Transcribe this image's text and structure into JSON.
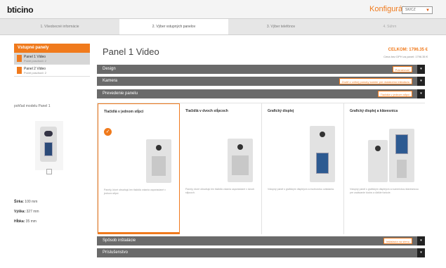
{
  "header": {
    "logo": "bticino",
    "app_title": "Konfigurátor",
    "language": "SK/CZ"
  },
  "wizard": {
    "steps": [
      {
        "label": "1. Všeobecné informácie"
      },
      {
        "label": "2. Výber vstupných panelov"
      },
      {
        "label": "3. Výber telefónov"
      },
      {
        "label": "4. Súhrn"
      }
    ],
    "active_index": 1
  },
  "sidebar": {
    "title": "Vstupné panely",
    "items": [
      {
        "name": "Panel 1 Video",
        "sub": "Počet poschodí: 2"
      },
      {
        "name": "Panel 2 Video",
        "sub": "Počet poschodí: 2"
      }
    ],
    "preview_label": "pohľad modelu Panel 1",
    "dims": {
      "width_label": "Šírka:",
      "width_value": "100 mm",
      "height_label": "Výška:",
      "height_value": "327 mm",
      "depth_label": "Hĺbka:",
      "depth_value": "35 mm"
    }
  },
  "main": {
    "title": "Panel 1 Video",
    "total_label": "CELKOM: 1796.35 €",
    "total_sub": "Cena bez DPH za panel: 1796.35 €",
    "sections": [
      {
        "label": "Design",
        "pill": "Pokračovať"
      },
      {
        "label": "Kamera",
        "pill": "Zvoliť z voľnej ponuky kamier pre dodatočnú inštaláciu"
      },
      {
        "label": "Prevedenie panelu",
        "pill": "Tlačidlá v jednom stĺpci"
      }
    ],
    "cards": [
      {
        "title": "Tlačidlá v jednom stĺpci",
        "desc": "Panely, ktoré obsahujú len tlačidlá volania usporiadané v jednom stĺpci."
      },
      {
        "title": "Tlačidlá v dvoch stĺpcoch",
        "desc": "Panely, ktoré obsahujú len tlačidlá volania usporiadané v dvoch stĺpcoch."
      },
      {
        "title": "Grafický displej",
        "desc": "Vstupný panel s grafickým displejom a možnosťou ovládania."
      },
      {
        "title": "Grafický displej a klávesnica",
        "desc": "Vstupný panel s grafickým displejom a numerickou klávesnicou pre zadávanie kódov a ďalšie funkcie."
      }
    ],
    "footer_sections": [
      {
        "label": "Spôsob inštalácie",
        "pill": "Inštalácia na stenu"
      },
      {
        "label": "Príslušenstvo",
        "pill": ""
      }
    ],
    "toggle_glyph": "▾"
  }
}
